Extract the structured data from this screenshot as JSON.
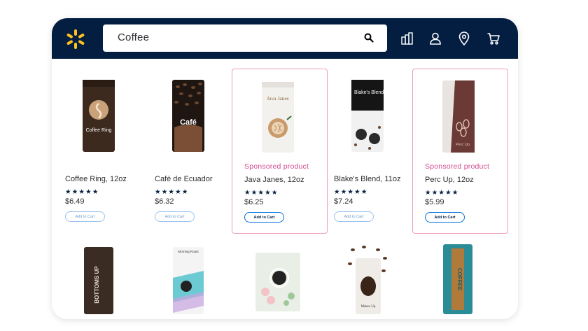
{
  "search": {
    "query": "Coffee"
  },
  "colors": {
    "header_bg": "#041e42",
    "spark": "#ffc220",
    "sponsored_border": "#f09cc0",
    "sponsored_text": "#d44d92",
    "button_border": "#0071dc"
  },
  "nav": {
    "icons": [
      "reorder-icon",
      "account-icon",
      "location-icon",
      "cart-icon"
    ]
  },
  "products": [
    {
      "name": "Coffee Ring, 12oz",
      "rating": "★★★★★",
      "price": "$6.49",
      "button": "Add to Cart",
      "package_text": "Coffee Ring"
    },
    {
      "name": "Café de Ecuador",
      "rating": "★★★★★",
      "price": "$6.32",
      "button": "Add to Cart",
      "package_text": "Café"
    },
    {
      "name": "Java Janes, 12oz",
      "rating": "★★★★★",
      "price": "$6.25",
      "button": "Add to Cart",
      "sponsored": "Sponsored product",
      "package_text": "Java Janes"
    },
    {
      "name": "Blake's Blend, 11oz",
      "rating": "★★★★★",
      "price": "$7.24",
      "button": "Add to Cart",
      "package_text": "Blake's Blend"
    },
    {
      "name": "Perc Up, 12oz",
      "rating": "★★★★★",
      "price": "$5.99",
      "button": "Add to Cart",
      "sponsored": "Sponsored product",
      "package_text": "Perc Up"
    }
  ],
  "second_row": [
    {
      "package_text": "BOTTOMS UP"
    },
    {
      "package_text": "Morning Roast"
    },
    {
      "package_text": ""
    },
    {
      "package_text": "Makes Up"
    },
    {
      "package_text": "COFFEE"
    }
  ]
}
